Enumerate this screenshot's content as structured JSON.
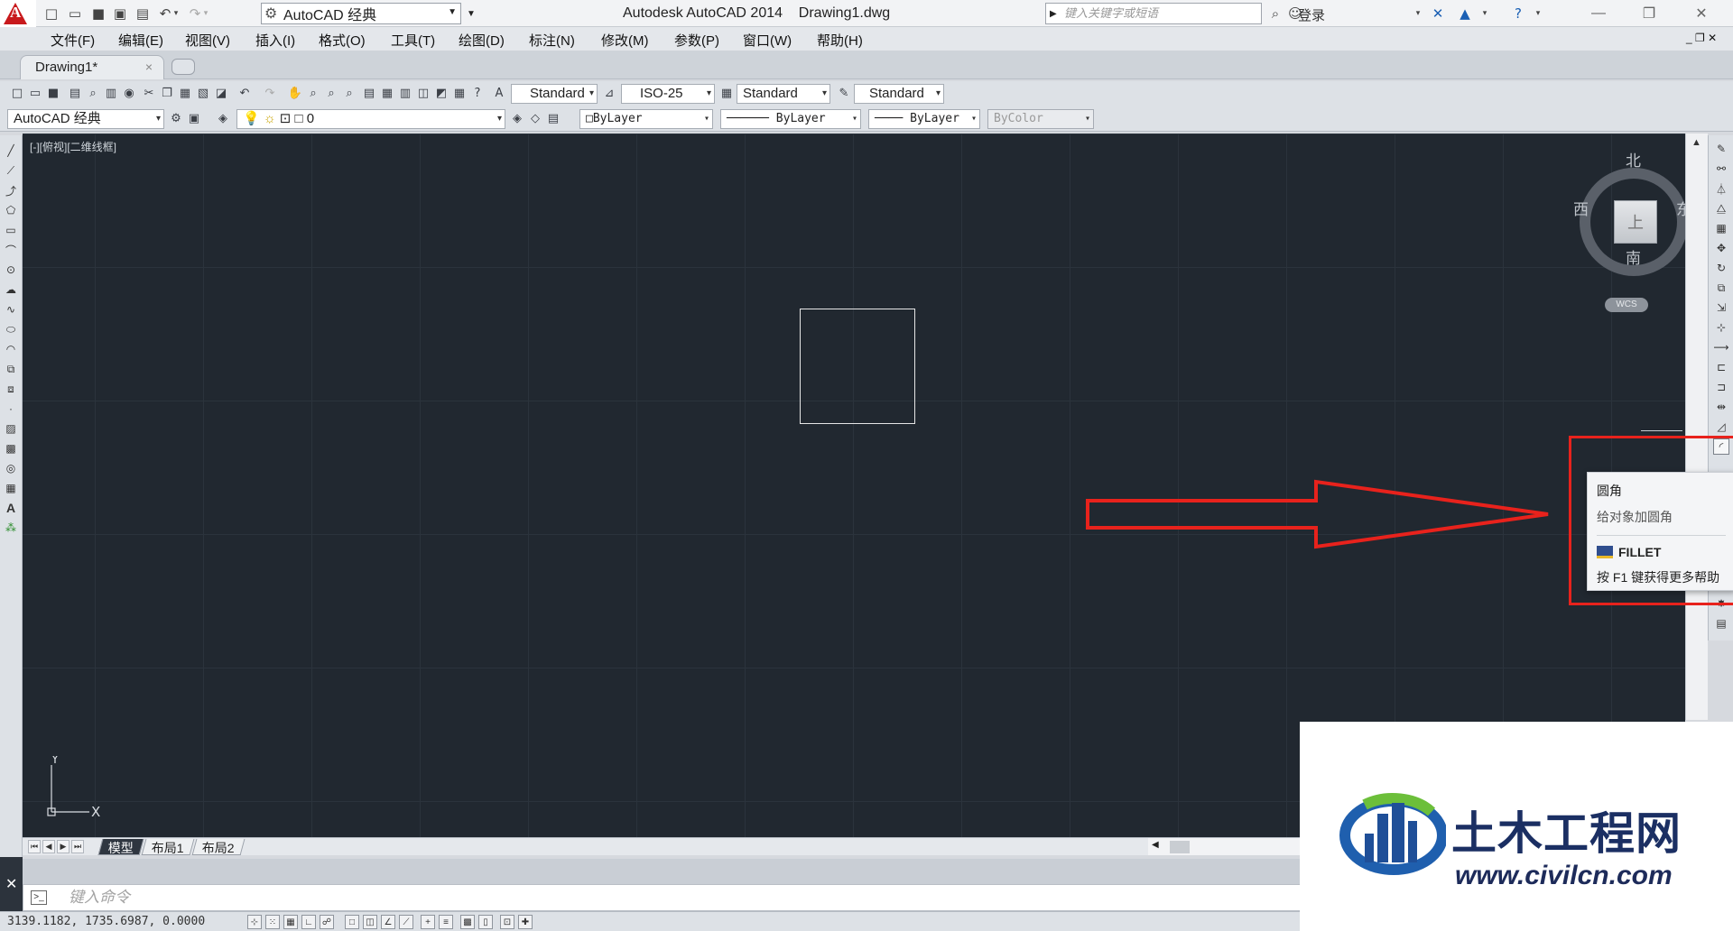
{
  "titlebar": {
    "workspace": "AutoCAD 经典",
    "title": "Autodesk AutoCAD 2014    Drawing1.dwg",
    "search_placeholder": "键入关键字或短语",
    "login": "登录"
  },
  "menu": [
    "文件(F)",
    "编辑(E)",
    "视图(V)",
    "插入(I)",
    "格式(O)",
    "工具(T)",
    "绘图(D)",
    "标注(N)",
    "修改(M)",
    "参数(P)",
    "窗口(W)",
    "帮助(H)"
  ],
  "file_tab": {
    "label": "Drawing1*",
    "close": "×"
  },
  "toolbar1": {
    "text_style": "Standard",
    "dim_style": "ISO-25",
    "table_style": "Standard",
    "mleader_style": "Standard"
  },
  "toolbar2": {
    "workspace": "AutoCAD 经典",
    "layer": "0",
    "color": "ByLayer",
    "linetype": "ByLayer",
    "lineweight": "ByLayer",
    "plotstyle": "ByColor"
  },
  "canvas": {
    "viewport_label": "[-][俯视][二维线框]",
    "ucs_x": "X",
    "ucs_y": "Y"
  },
  "viewcube": {
    "north": "北",
    "south": "南",
    "east": "东",
    "west": "西",
    "face": "上",
    "wcs": "WCS"
  },
  "tooltip": {
    "title": "圆角",
    "description": "给对象加圆角",
    "command": "FILLET",
    "help": "按 F1 键获得更多帮助"
  },
  "layout_tabs": [
    "模型",
    "布局1",
    "布局2"
  ],
  "command_line": {
    "placeholder": "键入命令"
  },
  "status": {
    "coords": "3139.1182, 1735.6987, 0.0000"
  },
  "watermark": {
    "title": "土木工程网",
    "url": "www.civilcn.com"
  },
  "colors": {
    "canvas_bg": "#212830",
    "annotation_red": "#e8221c",
    "autocad_red": "#c8191c"
  }
}
